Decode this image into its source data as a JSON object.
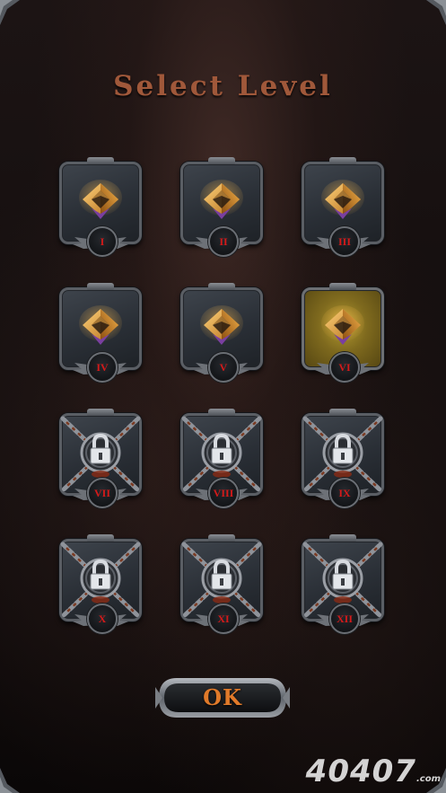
{
  "title": "Select Level",
  "levels": [
    {
      "numeral": "I",
      "state": "unlocked"
    },
    {
      "numeral": "II",
      "state": "unlocked"
    },
    {
      "numeral": "III",
      "state": "unlocked"
    },
    {
      "numeral": "IV",
      "state": "unlocked"
    },
    {
      "numeral": "V",
      "state": "unlocked"
    },
    {
      "numeral": "VI",
      "state": "selected"
    },
    {
      "numeral": "VII",
      "state": "locked"
    },
    {
      "numeral": "VIII",
      "state": "locked"
    },
    {
      "numeral": "IX",
      "state": "locked"
    },
    {
      "numeral": "X",
      "state": "locked"
    },
    {
      "numeral": "XI",
      "state": "locked"
    },
    {
      "numeral": "XII",
      "state": "locked"
    }
  ],
  "ok_button": {
    "label": "OK"
  },
  "watermark": {
    "main": "40407",
    "suffix": ".com"
  },
  "colors": {
    "title": "#a0583a",
    "numeral": "#d41a1a",
    "ok_text": "#e07a2a",
    "gem_gold": "#e0a030",
    "gem_purple": "#7a3fa0",
    "selected_glow": "#b39a30"
  },
  "icons": {
    "unlocked": "gold-diamond-gem-icon",
    "locked": "chained-padlock-icon"
  }
}
